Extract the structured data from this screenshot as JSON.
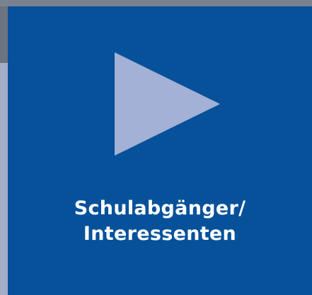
{
  "tile": {
    "label_line1": "Schulabgänger/",
    "label_line2": "Interessenten"
  },
  "icons": {
    "play": "play-icon"
  },
  "colors": {
    "tile_background": "#06519a",
    "play_icon": "#a3b1d6",
    "label_text": "#ffffff",
    "left_bar_light": "#a3adc8",
    "left_bar_dark": "#6b7480",
    "top_strip": "#7a8290"
  }
}
